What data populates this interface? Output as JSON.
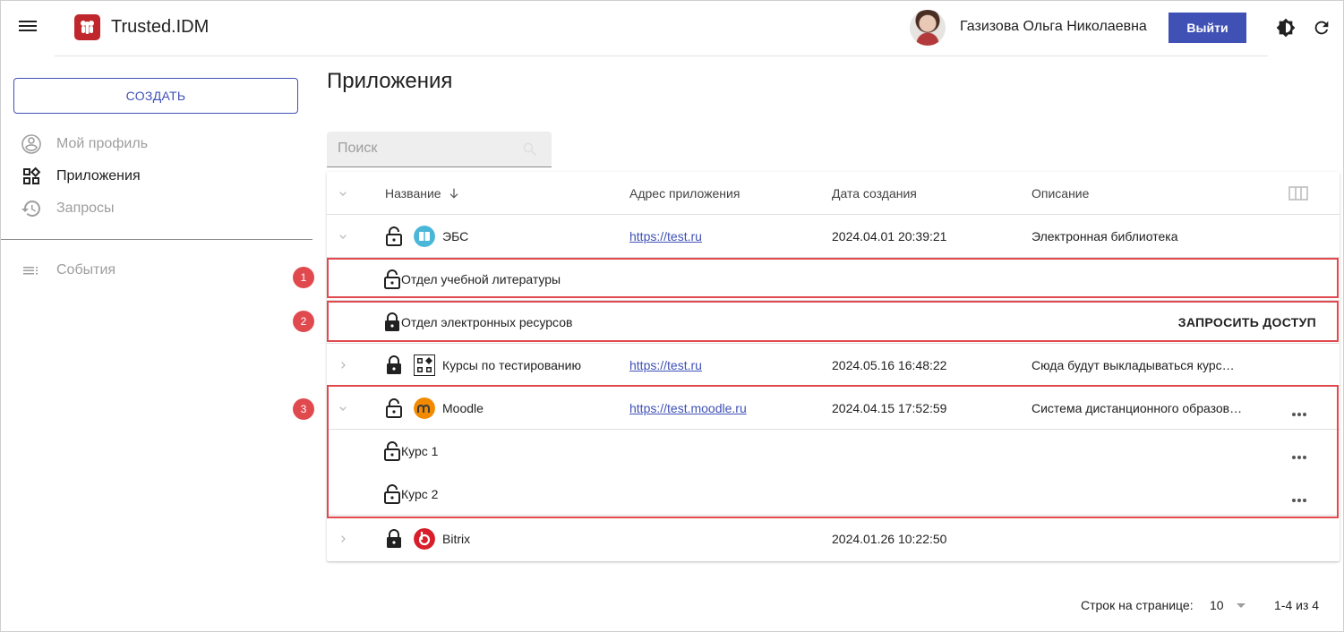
{
  "app": {
    "name": "Trusted.IDM"
  },
  "user": {
    "name": "Газизова Ольга Николаевна",
    "logout_label": "Выйти"
  },
  "sidebar": {
    "create_label": "СОЗДАТЬ",
    "items": [
      {
        "label": "Мой профиль",
        "icon": "account-circle-icon",
        "active": false
      },
      {
        "label": "Приложения",
        "icon": "apps-widgets-icon",
        "active": true
      },
      {
        "label": "Запросы",
        "icon": "history-icon",
        "active": false
      },
      {
        "label": "События",
        "icon": "list-events-icon",
        "active": false
      }
    ]
  },
  "page": {
    "title": "Приложения"
  },
  "search": {
    "placeholder": "Поиск"
  },
  "table": {
    "columns": [
      "Название",
      "Адрес приложения",
      "Дата создания",
      "Описание"
    ],
    "rows": [
      {
        "name": "ЭБС",
        "url": "https://test.ru",
        "date": "2024.04.01 20:39:21",
        "description": "Электронная библиотека",
        "icon": "book-icon",
        "lock": "unlocked",
        "expanded": true
      },
      {
        "name": "Отдел учебной литературы",
        "lock": "unlocked",
        "child": true
      },
      {
        "name": "Отдел электронных ресурсов",
        "lock": "locked",
        "child": true,
        "action": "ЗАПРОСИТЬ ДОСТУП"
      },
      {
        "name": "Курсы по тестированию",
        "url": "https://test.ru",
        "date": "2024.05.16 16:48:22",
        "description": "Сюда будут выкладываться курс…",
        "icon": "widgets-icon",
        "lock": "locked",
        "expanded": false
      },
      {
        "name": "Moodle",
        "url": "https://test.moodle.ru",
        "date": "2024.04.15 17:52:59",
        "description": "Система дистанционного образов…",
        "icon": "moodle-icon",
        "lock": "unlocked",
        "expanded": true
      },
      {
        "name": "Курс 1",
        "lock": "unlocked",
        "child": true
      },
      {
        "name": "Курс 2",
        "lock": "unlocked",
        "child": true
      },
      {
        "name": "Bitrix",
        "date": "2024.01.26 10:22:50",
        "icon": "bitrix-icon",
        "lock": "locked",
        "expanded": false
      }
    ]
  },
  "markers": [
    "1",
    "2",
    "3"
  ],
  "pagination": {
    "rows_label": "Строк на странице:",
    "rows_per_page": "10",
    "range": "1-4 из 4"
  },
  "colors": {
    "accent": "#3f51b5",
    "brand": "#c0272d",
    "highlight": "#e04a4f"
  }
}
